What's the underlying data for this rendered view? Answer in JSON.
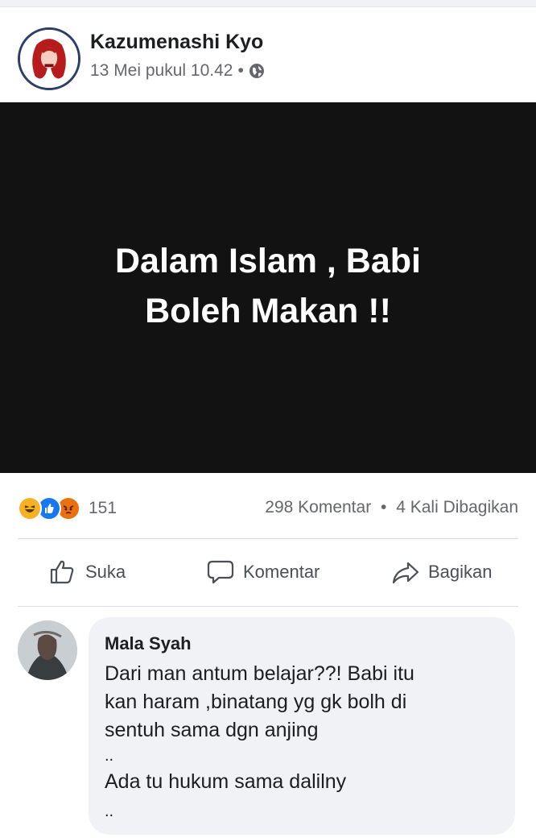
{
  "post": {
    "author": "Kazumenashi Kyo",
    "timestamp": "13 Mei pukul 10.42",
    "separator": "•",
    "privacy_icon": "globe-icon",
    "image_text_line1": "Dalam Islam , Babi",
    "image_text_line2": "Boleh Makan !!",
    "image_bg": "#121213"
  },
  "stats": {
    "reaction_icons": [
      "haha-icon",
      "like-icon",
      "angry-icon"
    ],
    "reaction_count": "151",
    "comments": "298 Komentar",
    "separator": "•",
    "shares": "4 Kali Dibagikan"
  },
  "actions": {
    "like_label": "Suka",
    "comment_label": "Komentar",
    "share_label": "Bagikan"
  },
  "comment": {
    "name": "Mala Syah",
    "lines": [
      "Dari man antum belajar??! Babi itu",
      "kan haram ,binatang yg gk bolh di",
      "sentuh sama dgn anjing",
      "..",
      "Ada tu hukum sama dalilny",
      ".."
    ]
  },
  "colors": {
    "text_primary": "#1c1e21",
    "text_secondary": "#65676b",
    "like_blue": "#1877f2",
    "bubble_bg": "#f0f2f5"
  }
}
